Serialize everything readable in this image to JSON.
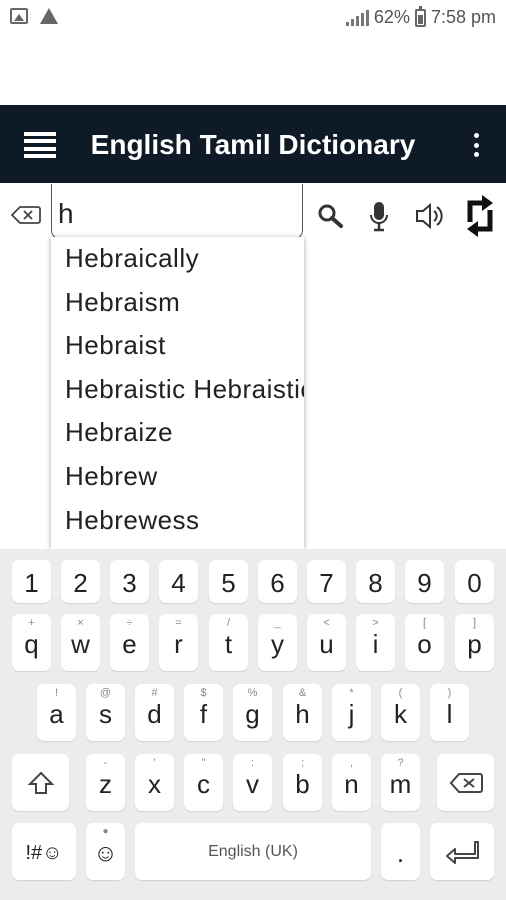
{
  "status_bar": {
    "left_icons": [
      "image-icon",
      "warning-icon"
    ],
    "battery": "62%",
    "time": "7:58 pm"
  },
  "app_bar": {
    "title": "English Tamil Dictionary",
    "menu_icon": "menu-icon",
    "overflow_icon": "more-vert-icon",
    "background": "#0e1a26"
  },
  "search": {
    "value": "h",
    "tools": [
      "search-icon",
      "mic-icon",
      "speaker-icon",
      "swap-icon"
    ]
  },
  "suggestions": [
    "Hebraically",
    "Hebraism",
    "Hebraist",
    "Hebraistic  Hebraistical",
    "Hebraize",
    "Hebrew",
    "Hebrewess"
  ],
  "keyboard": {
    "number_row": [
      "1",
      "2",
      "3",
      "4",
      "5",
      "6",
      "7",
      "8",
      "9",
      "0"
    ],
    "row1": [
      {
        "key": "q",
        "hint": "+"
      },
      {
        "key": "w",
        "hint": "×"
      },
      {
        "key": "e",
        "hint": "÷"
      },
      {
        "key": "r",
        "hint": "="
      },
      {
        "key": "t",
        "hint": "/"
      },
      {
        "key": "y",
        "hint": "_"
      },
      {
        "key": "u",
        "hint": "<"
      },
      {
        "key": "i",
        "hint": ">"
      },
      {
        "key": "o",
        "hint": "["
      },
      {
        "key": "p",
        "hint": "]"
      }
    ],
    "row2": [
      {
        "key": "a",
        "hint": "!"
      },
      {
        "key": "s",
        "hint": "@"
      },
      {
        "key": "d",
        "hint": "#"
      },
      {
        "key": "f",
        "hint": "$"
      },
      {
        "key": "g",
        "hint": "%"
      },
      {
        "key": "h",
        "hint": "&"
      },
      {
        "key": "j",
        "hint": "*"
      },
      {
        "key": "k",
        "hint": "("
      },
      {
        "key": "l",
        "hint": ")"
      }
    ],
    "row3": [
      {
        "key": "z",
        "hint": "-"
      },
      {
        "key": "x",
        "hint": "'"
      },
      {
        "key": "c",
        "hint": "\""
      },
      {
        "key": "v",
        "hint": ":"
      },
      {
        "key": "b",
        "hint": ";"
      },
      {
        "key": "n",
        "hint": ","
      },
      {
        "key": "m",
        "hint": "?"
      }
    ],
    "symbols_label": "!#☺",
    "emoji_label": "☺",
    "space_label": "English (UK)",
    "period_label": "."
  }
}
